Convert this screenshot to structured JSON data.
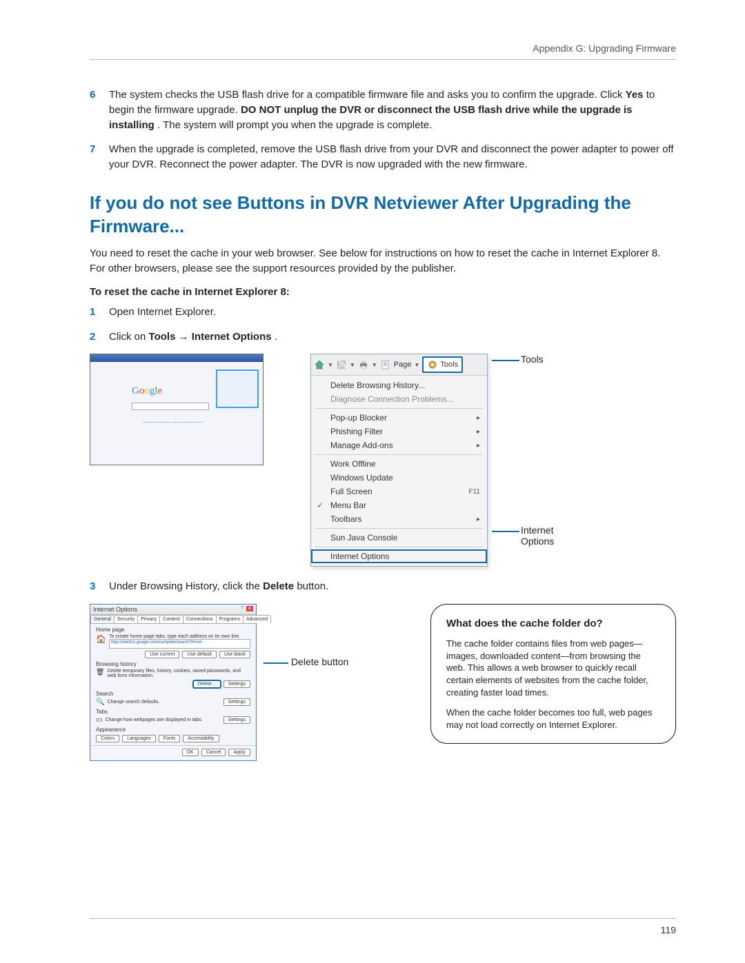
{
  "header": {
    "appendix": "Appendix G: Upgrading Firmware"
  },
  "steps_a": [
    {
      "num": "6",
      "pre": "The system checks the USB flash drive for a compatible firmware file and asks you to confirm the upgrade. Click ",
      "b1": "Yes",
      "mid": " to begin the firmware upgrade. ",
      "b2": "DO NOT unplug the DVR or disconnect the USB flash drive while the upgrade is installing",
      "post": ". The system will prompt you when the upgrade is complete."
    },
    {
      "num": "7",
      "pre": "When the upgrade is completed, remove the USB flash drive from your DVR and disconnect the power adapter to power off your DVR. Reconnect the power adapter. The DVR is now upgraded with the new firmware.",
      "b1": "",
      "mid": "",
      "b2": "",
      "post": ""
    }
  ],
  "section_title": "If you do not see Buttons in DVR Netviewer After Upgrading the Firmware...",
  "section_intro": "You need to reset the cache in your web browser. See below for instructions on how to reset the cache in Internet Explorer 8. For other browsers, please see the support resources provided by the publisher.",
  "reset_head": "To reset the cache in Internet Explorer 8:",
  "steps_b": {
    "s1": {
      "num": "1",
      "text": "Open Internet Explorer."
    },
    "s2": {
      "num": "2",
      "pre": "Click on ",
      "b1": "Tools",
      "arrow": "→",
      "b2": "Internet Options",
      "post": "."
    },
    "s3": {
      "num": "3",
      "pre": "Under Browsing History, click the ",
      "b1": "Delete",
      "post": " button."
    }
  },
  "tools_menu": {
    "toolbar": {
      "page": "Page",
      "tools": "Tools"
    },
    "items": {
      "del_hist": "Delete Browsing History...",
      "diag": "Diagnose Connection Problems...",
      "popup": "Pop-up Blocker",
      "phish": "Phishing Filter",
      "addons": "Manage Add-ons",
      "offline": "Work Offline",
      "winupd": "Windows Update",
      "fullscreen": "Full Screen",
      "fullscreen_key": "F11",
      "menubar": "Menu Bar",
      "toolbars": "Toolbars",
      "sunjava": "Sun Java Console",
      "iopt": "Internet Options"
    },
    "callout_tools": "Tools",
    "callout_iopt_l1": "Internet",
    "callout_iopt_l2": "Options"
  },
  "iopt_dialog": {
    "title": "Internet Options",
    "tabs": [
      "General",
      "Security",
      "Privacy",
      "Content",
      "Connections",
      "Programs",
      "Advanced"
    ],
    "home_section": "Home page",
    "home_text": "To create home page tabs, type each address on its own line.",
    "home_url": "http://clients1.google.com/complete/search?hl=en",
    "home_btns": [
      "Use current",
      "Use default",
      "Use blank"
    ],
    "bh_section": "Browsing history",
    "bh_text": "Delete temporary files, history, cookies, saved passwords, and web form information.",
    "bh_btns": [
      "Delete...",
      "Settings"
    ],
    "search_section": "Search",
    "search_text": "Change search defaults.",
    "search_btn": "Settings",
    "tabs_section": "Tabs",
    "tabs_text": "Change how webpages are displayed in tabs.",
    "tabs_btn": "Settings",
    "appearance_section": "Appearance",
    "appearance_btns": [
      "Colors",
      "Languages",
      "Fonts",
      "Accessibility"
    ],
    "footer_btns": [
      "OK",
      "Cancel",
      "Apply"
    ]
  },
  "delete_callout": "Delete button",
  "info_box": {
    "title": "What does the cache folder do?",
    "p1": "The cache folder contains files from web pages—images, downloaded content—from browsing the web. This allows a web browser to quickly recall certain elements of websites from the cache folder, creating faster load times.",
    "p2": "When the cache folder becomes too full, web pages may not load correctly on Internet Explorer."
  },
  "page_number": "119"
}
